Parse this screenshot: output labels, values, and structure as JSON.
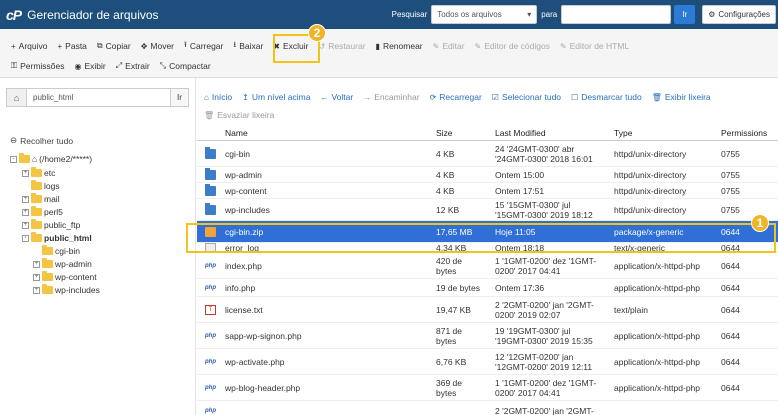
{
  "app": {
    "logo": "cP",
    "title": "Gerenciador de arquivos"
  },
  "search": {
    "label": "Pesquisar",
    "scope": "Todos os arquivos",
    "for_label": "para",
    "go": "Ir",
    "settings": "Configurações"
  },
  "toolbar": {
    "row1": [
      {
        "icon": "+",
        "label": "Arquivo",
        "disabled": false
      },
      {
        "icon": "+",
        "label": "Pasta",
        "disabled": false
      },
      {
        "icon": "⧉",
        "label": "Copiar",
        "disabled": false
      },
      {
        "icon": "✥",
        "label": "Mover",
        "disabled": false
      },
      {
        "icon": "⭱",
        "label": "Carregar",
        "disabled": false
      },
      {
        "icon": "⭳",
        "label": "Baixar",
        "disabled": false
      },
      {
        "icon": "✖",
        "label": "Excluir",
        "disabled": false
      },
      {
        "icon": "↺",
        "label": "Restaurar",
        "disabled": true
      },
      {
        "icon": "▮",
        "label": "Renomear",
        "disabled": false
      },
      {
        "icon": "✎",
        "label": "Editar",
        "disabled": true
      },
      {
        "icon": "✎",
        "label": "Editor de códigos",
        "disabled": true
      },
      {
        "icon": "✎",
        "label": "Editor de HTML",
        "disabled": true
      }
    ],
    "row2": [
      {
        "icon": "⚿",
        "label": "Permissões",
        "disabled": false
      },
      {
        "icon": "◉",
        "label": "Exibir",
        "disabled": false
      },
      {
        "icon": "⤢",
        "label": "Extrair",
        "disabled": false
      },
      {
        "icon": "⤡",
        "label": "Compactar",
        "disabled": false
      }
    ]
  },
  "badges": {
    "one": "1",
    "two": "2"
  },
  "left": {
    "path_value": "public_html",
    "path_go": "Ir",
    "collapse_label": "Recolher tudo",
    "tree": {
      "root": "(/home2/*****)",
      "etc": "etc",
      "logs": "logs",
      "mail": "mail",
      "perl5": "perl5",
      "public_ftp": "public_ftp",
      "public_html": "public_html",
      "cgi_bin": "cgi-bin",
      "wp_admin": "wp-admin",
      "wp_content": "wp-content",
      "wp_includes": "wp-includes"
    }
  },
  "nav": {
    "home": "Início",
    "up": "Um nível acima",
    "back": "Voltar",
    "forward": "Encaminhar",
    "reload": "Recarregar",
    "select_all": "Selecionar tudo",
    "deselect_all": "Desmarcar tudo",
    "trash": "Exibir lixeira",
    "empty_trash": "Esvaziar lixeira"
  },
  "table": {
    "headers": {
      "name": "Name",
      "size": "Size",
      "modified": "Last Modified",
      "type": "Type",
      "perms": "Permissions"
    },
    "rows": [
      {
        "icon": "dir",
        "name": "cgi-bin",
        "size": "4 KB",
        "mod1": "24 '24GMT-0300' abr",
        "mod2": "'24GMT-0300' 2018 16:01",
        "type": "httpd/unix-directory",
        "perms": "0755"
      },
      {
        "icon": "dir",
        "name": "wp-admin",
        "size": "4 KB",
        "mod1": "Ontem 15:00",
        "mod2": "",
        "type": "httpd/unix-directory",
        "perms": "0755"
      },
      {
        "icon": "dir",
        "name": "wp-content",
        "size": "4 KB",
        "mod1": "Ontem 17:51",
        "mod2": "",
        "type": "httpd/unix-directory",
        "perms": "0755"
      },
      {
        "icon": "dir",
        "name": "wp-includes",
        "size": "12 KB",
        "mod1": "15 '15GMT-0300' jul",
        "mod2": "'15GMT-0300' 2019 18:12",
        "type": "httpd/unix-directory",
        "perms": "0755"
      },
      {
        "icon": "zip",
        "name": "cgi-bin.zip",
        "size": "17,65 MB",
        "mod1": "Hoje 11:05",
        "mod2": "",
        "type": "package/x-generic",
        "perms": "0644"
      },
      {
        "icon": "log",
        "name": "error_log",
        "size": "4,34 KB",
        "mod1": "Ontem 18:18",
        "mod2": "",
        "type": "text/x-generic",
        "perms": "0644"
      },
      {
        "icon": "php",
        "name": "index.php",
        "size": "420 de",
        "size2": "bytes",
        "mod1": "1 '1GMT-0200' dez '1GMT-",
        "mod2": "0200' 2017 04:41",
        "type": "application/x-httpd-php",
        "perms": "0644"
      },
      {
        "icon": "php",
        "name": "info.php",
        "size": "19 de bytes",
        "mod1": "Ontem 17:36",
        "mod2": "",
        "type": "application/x-httpd-php",
        "perms": "0644"
      },
      {
        "icon": "txt",
        "name": "license.txt",
        "size": "19,47 KB",
        "mod1": "2 '2GMT-0200' jan '2GMT-",
        "mod2": "0200' 2019 02:07",
        "type": "text/plain",
        "perms": "0644"
      },
      {
        "icon": "php",
        "name": "sapp-wp-signon.php",
        "size": "871 de",
        "size2": "bytes",
        "mod1": "19 '19GMT-0300' jul",
        "mod2": "'19GMT-0300' 2019 15:35",
        "type": "application/x-httpd-php",
        "perms": "0644"
      },
      {
        "icon": "php",
        "name": "wp-activate.php",
        "size": "6,76 KB",
        "mod1": "12 '12GMT-0200' jan",
        "mod2": "'12GMT-0200' 2019 12:11",
        "type": "application/x-httpd-php",
        "perms": "0644"
      },
      {
        "icon": "php",
        "name": "wp-blog-header.php",
        "size": "369 de",
        "size2": "bytes",
        "mod1": "1 '1GMT-0200' dez '1GMT-",
        "mod2": "0200' 2017 04:41",
        "type": "application/x-httpd-php",
        "perms": "0644"
      },
      {
        "icon": "php",
        "name": "",
        "size": "",
        "mod1": "2 '2GMT-0200' jan '2GMT-",
        "mod2": "",
        "type": "",
        "perms": ""
      }
    ]
  }
}
